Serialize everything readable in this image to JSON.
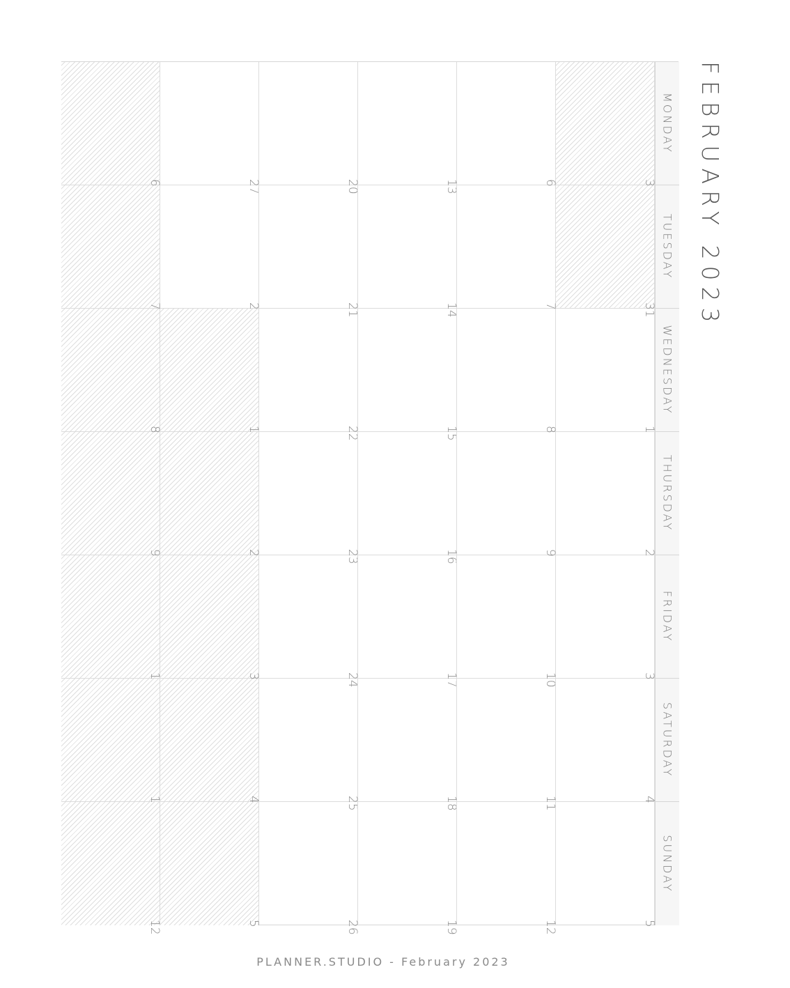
{
  "title": "FEBRUARY 2023",
  "footer": "PLANNER.STUDIO - February 2023",
  "weekdays": [
    "MONDAY",
    "TUESDAY",
    "WEDNESDAY",
    "THURSDAY",
    "FRIDAY",
    "SATURDAY",
    "SUNDAY"
  ],
  "weeks": [
    [
      {
        "day": "30",
        "out": true
      },
      {
        "day": "31",
        "out": true
      },
      {
        "day": "1",
        "out": false
      },
      {
        "day": "2",
        "out": false
      },
      {
        "day": "3",
        "out": false
      },
      {
        "day": "4",
        "out": false
      },
      {
        "day": "5",
        "out": false
      }
    ],
    [
      {
        "day": "6",
        "out": false
      },
      {
        "day": "7",
        "out": false
      },
      {
        "day": "8",
        "out": false
      },
      {
        "day": "9",
        "out": false
      },
      {
        "day": "10",
        "out": false
      },
      {
        "day": "11",
        "out": false
      },
      {
        "day": "12",
        "out": false
      }
    ],
    [
      {
        "day": "13",
        "out": false
      },
      {
        "day": "14",
        "out": false
      },
      {
        "day": "15",
        "out": false
      },
      {
        "day": "16",
        "out": false
      },
      {
        "day": "17",
        "out": false
      },
      {
        "day": "18",
        "out": false
      },
      {
        "day": "19",
        "out": false
      }
    ],
    [
      {
        "day": "20",
        "out": false
      },
      {
        "day": "21",
        "out": false
      },
      {
        "day": "22",
        "out": false
      },
      {
        "day": "23",
        "out": false
      },
      {
        "day": "24",
        "out": false
      },
      {
        "day": "25",
        "out": false
      },
      {
        "day": "26",
        "out": false
      }
    ],
    [
      {
        "day": "27",
        "out": false
      },
      {
        "day": "28",
        "out": false
      },
      {
        "day": "1",
        "out": true
      },
      {
        "day": "2",
        "out": true
      },
      {
        "day": "3",
        "out": true
      },
      {
        "day": "4",
        "out": true
      },
      {
        "day": "5",
        "out": true
      }
    ],
    [
      {
        "day": "6",
        "out": true
      },
      {
        "day": "7",
        "out": true
      },
      {
        "day": "8",
        "out": true
      },
      {
        "day": "9",
        "out": true
      },
      {
        "day": "10",
        "out": true
      },
      {
        "day": "11",
        "out": true
      },
      {
        "day": "12",
        "out": true
      }
    ]
  ]
}
